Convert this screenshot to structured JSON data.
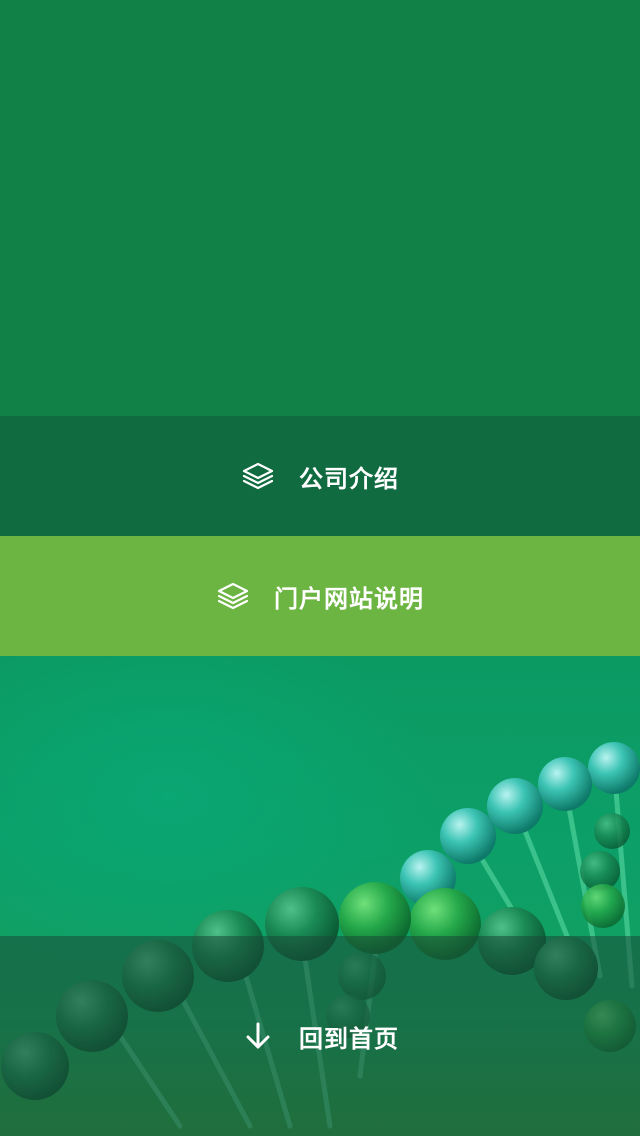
{
  "menu": {
    "items": [
      {
        "label": "公司介绍",
        "icon": "layers-icon"
      },
      {
        "label": "门户网站说明",
        "icon": "layers-icon"
      }
    ]
  },
  "footer": {
    "home_label": "回到首页",
    "home_icon": "arrow-down-icon"
  },
  "colors": {
    "background_top": "#118147",
    "menu_item_dark": "#106b40",
    "menu_item_active": "#6db543",
    "background_lower": "#0b9a62",
    "text": "#ffffff"
  }
}
